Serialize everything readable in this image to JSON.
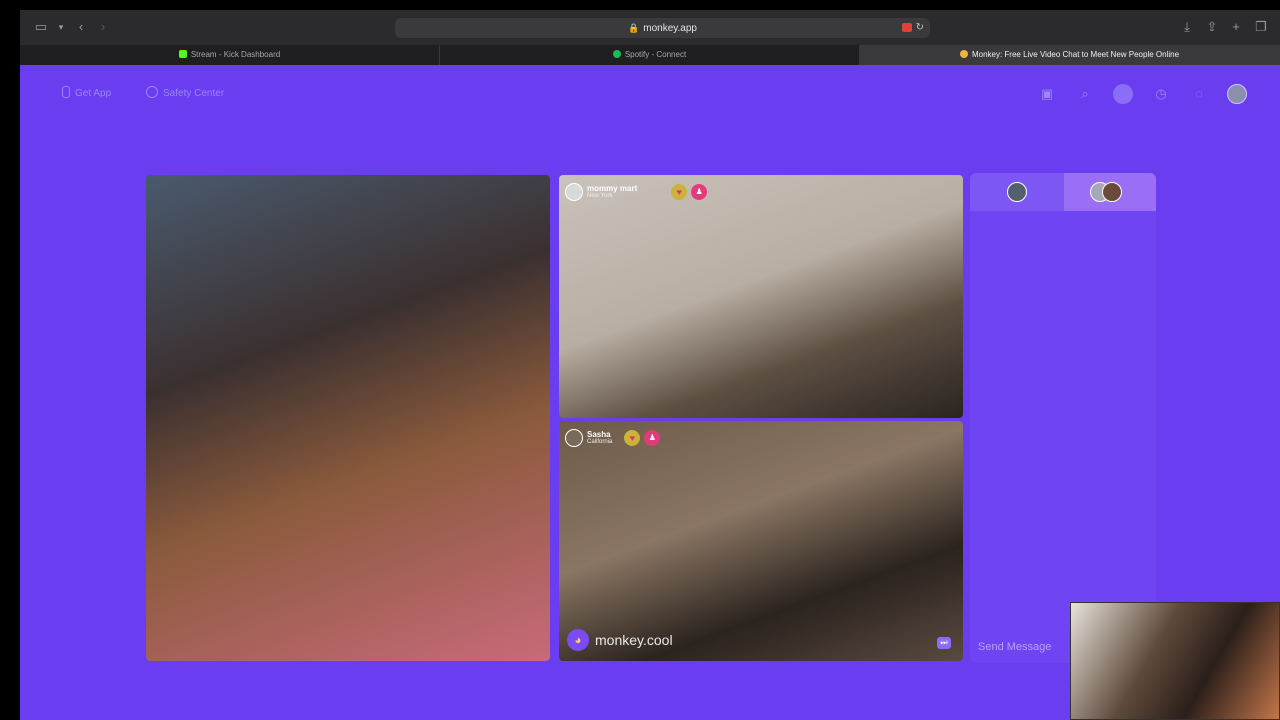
{
  "browser": {
    "url": "monkey.app",
    "tabs": [
      {
        "label": "Stream - Kick Dashboard",
        "icon": "kick-favicon",
        "color": "#53fc18"
      },
      {
        "label": "Spotify - Connect",
        "icon": "spotify-favicon",
        "color": "#1db954"
      },
      {
        "label": "Monkey: Free Live Video Chat to Meet New People Online",
        "icon": "monkey-favicon",
        "color": "#f2b33d"
      }
    ]
  },
  "app": {
    "nav_left": [
      {
        "label": "Get App",
        "icon": "phone-icon"
      },
      {
        "label": "Safety Center",
        "icon": "shield-icon"
      }
    ],
    "accent": "#6a3df0",
    "participants": [
      {
        "name": "mommy mart",
        "location": "New York"
      },
      {
        "name": "Sasha",
        "location": "California"
      }
    ],
    "watermark": "monkey.cool",
    "chat": {
      "placeholder": "Send Message"
    }
  }
}
